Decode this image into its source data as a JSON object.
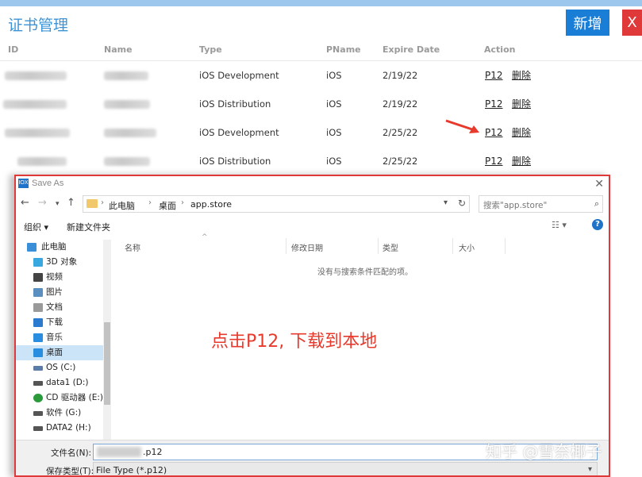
{
  "page": {
    "title": "证书管理",
    "add_label": "新增",
    "close_label": "X"
  },
  "table": {
    "headers": [
      "ID",
      "Name",
      "Type",
      "PName",
      "Expire Date",
      "Action"
    ],
    "rows": [
      {
        "type": "iOS Development",
        "pname": "iOS",
        "expire": "2/19/22",
        "download": "P12",
        "delete": "删除"
      },
      {
        "type": "iOS Distribution",
        "pname": "iOS",
        "expire": "2/19/22",
        "download": "P12",
        "delete": "删除"
      },
      {
        "type": "iOS Development",
        "pname": "iOS",
        "expire": "2/25/22",
        "download": "P12",
        "delete": "删除"
      },
      {
        "type": "iOS Distribution",
        "pname": "iOS",
        "expire": "2/25/22",
        "download": "P12",
        "delete": "删除"
      }
    ]
  },
  "dialog": {
    "title": "Save As",
    "app_icon_text": "IOX",
    "breadcrumb": [
      "此电脑",
      "桌面",
      "app.store"
    ],
    "search_placeholder": "搜索\"app.store\"",
    "toolbar": {
      "organize": "组织 ▾",
      "new_folder": "新建文件夹"
    },
    "sidebar": [
      {
        "label": "此电脑",
        "icon": "computer-icon",
        "color": "#3a8fd8"
      },
      {
        "label": "3D 对象",
        "icon": "cube-icon",
        "color": "#39a8e0"
      },
      {
        "label": "视频",
        "icon": "video-icon",
        "color": "#444444"
      },
      {
        "label": "图片",
        "icon": "picture-icon",
        "color": "#5a8fc0"
      },
      {
        "label": "文档",
        "icon": "document-icon",
        "color": "#9a9a9a"
      },
      {
        "label": "下载",
        "icon": "download-icon",
        "color": "#2a7ad0"
      },
      {
        "label": "音乐",
        "icon": "music-icon",
        "color": "#2a8ee0"
      },
      {
        "label": "桌面",
        "icon": "desktop-icon",
        "color": "#2a8ee0",
        "selected": true
      },
      {
        "label": "OS (C:)",
        "icon": "drive-icon",
        "color": "#5a7da8"
      },
      {
        "label": "data1 (D:)",
        "icon": "drive-icon",
        "color": "#555555"
      },
      {
        "label": "CD 驱动器 (E:) I",
        "icon": "cd-drive-icon",
        "color": "#2a9a3a"
      },
      {
        "label": "软件 (G:)",
        "icon": "drive-icon",
        "color": "#555555"
      },
      {
        "label": "DATA2 (H:)",
        "icon": "drive-icon",
        "color": "#555555"
      }
    ],
    "columns": [
      "名称",
      "修改日期",
      "类型",
      "大小"
    ],
    "empty_message": "没有与搜索条件匹配的项。",
    "filename_label": "文件名(N):",
    "filename_value": ".p12",
    "filetype_label": "保存类型(T):",
    "filetype_value": "File Type (*.p12)"
  },
  "annotation": "点击P12, 下载到本地",
  "watermark": "知乎 @雪奈椰子",
  "colors": {
    "accent": "#1a7ed6",
    "danger": "#e0393a",
    "annotation": "#e83a2c"
  }
}
